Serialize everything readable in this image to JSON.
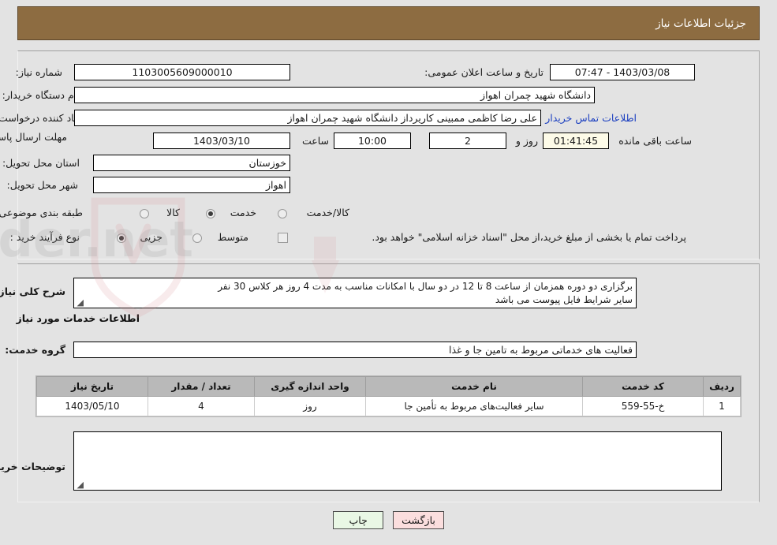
{
  "header": {
    "title": "جزئیات اطلاعات نیاز"
  },
  "form": {
    "need_number_label": "شماره نیاز:",
    "need_number_value": "1103005609000010",
    "announce_datetime_label": "تاریخ و ساعت اعلان عمومی:",
    "announce_datetime_value": "1403/03/08 - 07:47",
    "buyer_org_label": "نام دستگاه خریدار:",
    "buyer_org_value": "دانشگاه شهید چمران اهواز",
    "requester_label": "ایجاد کننده درخواست:",
    "requester_value": "علی رضا کاظمی ممبینی کاریرداز دانشگاه شهید چمران اهواز",
    "buyer_contact_link": "اطلاعات تماس خریدار",
    "deadline_label": "مهلت ارسال پاسخ: تا تاریخ:",
    "deadline_date": "1403/03/10",
    "deadline_hour_label": "ساعت",
    "deadline_hour_value": "10:00",
    "remaining_days_value": "2",
    "remaining_days_label": "روز و",
    "remaining_time_value": "01:41:45",
    "remaining_time_label": "ساعت باقی مانده",
    "province_label": "استان محل تحویل:",
    "province_value": "خوزستان",
    "city_label": "شهر محل تحویل:",
    "city_value": "اهواز",
    "classification_label": "طبقه بندی موضوعی:",
    "classification_options": [
      {
        "label": "کالا",
        "selected": false
      },
      {
        "label": "خدمت",
        "selected": true
      },
      {
        "label": "کالا/خدمت",
        "selected": false
      }
    ],
    "process_type_label": "نوع فرآیند خرید :",
    "process_type_options": [
      {
        "label": "جزیی",
        "selected": true
      },
      {
        "label": "متوسط",
        "selected": false
      }
    ],
    "treasury_checkbox_checked": false,
    "treasury_note": "پرداخت تمام یا بخشی از مبلغ خرید،از محل \"اسناد خزانه اسلامی\" خواهد بود."
  },
  "description": {
    "general_label": "شرح کلی نیاز:",
    "general_value": "برگزاری دو دوره همزمان از ساعت 8 تا 12 در دو سال با امکانات مناسب به مدت 4 روز هر کلاس 30 نفر\nسایر شرایط فایل پیوست می باشد",
    "services_section_title": "اطلاعات خدمات مورد نیاز",
    "service_group_label": "گروه خدمت:",
    "service_group_value": "فعالیت های خدماتی مربوط به تامین جا و غذا",
    "buyer_notes_label": "توضیحات خریدار:",
    "buyer_notes_value": ""
  },
  "table": {
    "headers": [
      "ردیف",
      "کد خدمت",
      "نام خدمت",
      "واحد اندازه گیری",
      "تعداد / مقدار",
      "تاریخ نیاز"
    ],
    "rows": [
      {
        "row_no": "1",
        "service_code": "خ-55-559",
        "service_name": "سایر فعالیت‌های مربوط به تأمین جا",
        "unit": "روز",
        "quantity": "4",
        "need_date": "1403/05/10"
      }
    ]
  },
  "buttons": {
    "print": "چاپ",
    "back": "بازگشت"
  },
  "colors": {
    "header_bg": "#8d6c41",
    "page_bg": "#e3e3e3",
    "link": "#1b3fc0",
    "table_header_bg": "#b9b9b9",
    "print_btn_bg": "#e9f7e5",
    "back_btn_bg": "#fbdede"
  }
}
